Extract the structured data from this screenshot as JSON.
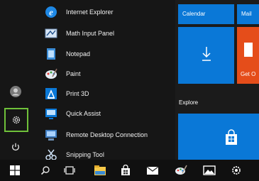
{
  "apps": [
    {
      "label": "Internet Explorer",
      "icon": "internet-explorer-icon"
    },
    {
      "label": "Math Input Panel",
      "icon": "math-input-panel-icon"
    },
    {
      "label": "Notepad",
      "icon": "notepad-icon"
    },
    {
      "label": "Paint",
      "icon": "paint-icon"
    },
    {
      "label": "Print 3D",
      "icon": "print-3d-icon"
    },
    {
      "label": "Quick Assist",
      "icon": "quick-assist-icon"
    },
    {
      "label": "Remote Desktop Connection",
      "icon": "remote-desktop-icon"
    },
    {
      "label": "Snipping Tool",
      "icon": "snipping-tool-icon"
    }
  ],
  "tiles": {
    "calendar_label": "Calendar",
    "mail_label": "Mail",
    "get_office_label": "Get O",
    "explore_label": "Explore"
  },
  "colors": {
    "accent": "#0a78d7",
    "office_orange": "#e54d1a",
    "settings_highlight": "#6fc13a"
  },
  "rail_icons": [
    "user-avatar-icon",
    "settings-gear-icon",
    "power-icon"
  ],
  "taskbar_icons": [
    "windows-start-icon",
    "search-icon",
    "task-view-icon",
    "file-explorer-icon",
    "store-icon",
    "mail-icon",
    "paint-icon",
    "photos-icon",
    "settings-icon"
  ]
}
